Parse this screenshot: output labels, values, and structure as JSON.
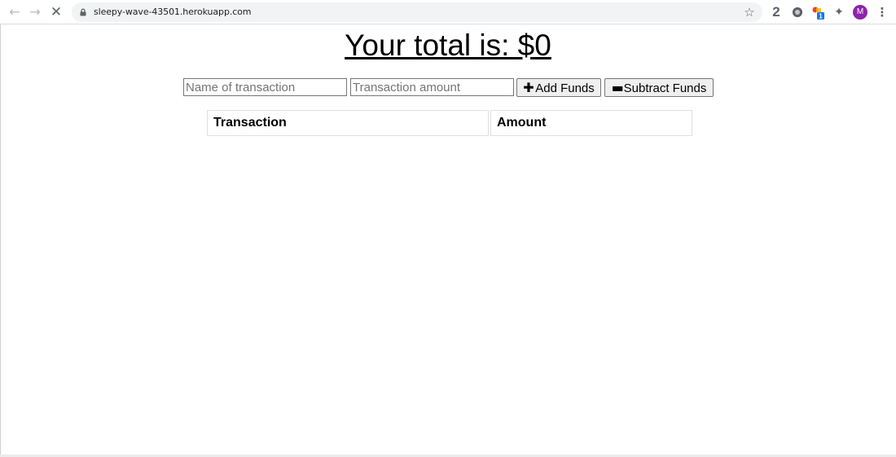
{
  "browser": {
    "url": "sleepy-wave-43501.herokuapp.com",
    "ext_badge_count": "1",
    "ext_letter": "2",
    "avatar_initial": "M"
  },
  "main": {
    "total_text": "Your total is: $0"
  },
  "form": {
    "name_placeholder": "Name of transaction",
    "amount_placeholder": "Transaction amount",
    "add_label": "Add Funds",
    "subtract_label": "Subtract Funds"
  },
  "table": {
    "headers": [
      "Transaction",
      "Amount"
    ],
    "rows": []
  },
  "colors": {
    "avatar": "#8e24aa",
    "badge": "#1a73e8"
  },
  "icons": {
    "back": "arrow-left-icon",
    "forward": "arrow-right-icon",
    "stop": "close-icon",
    "lock": "lock-icon",
    "bookmark": "star-icon",
    "extensions": "puzzle-icon",
    "menu": "kebab-menu-icon",
    "add": "plus-icon",
    "subtract": "minus-icon"
  }
}
